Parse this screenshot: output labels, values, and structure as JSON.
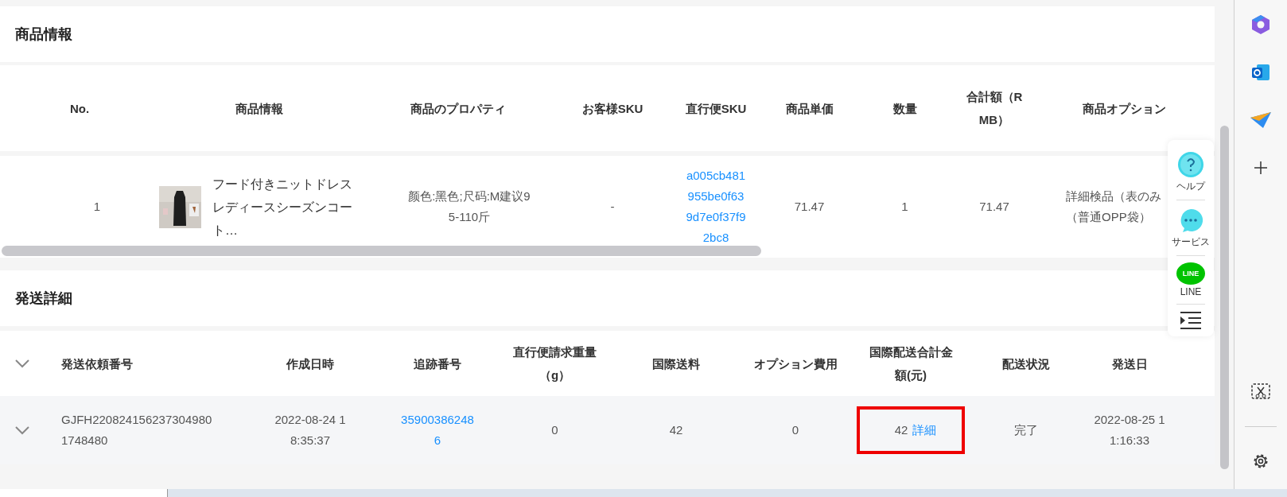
{
  "product_section": {
    "title": "商品情報",
    "columns": [
      "No.",
      "商品情報",
      "商品のプロパティ",
      "お客様SKU",
      "直行便SKU",
      "商品単価",
      "数量",
      "合計額（RMB）",
      "商品オプション"
    ],
    "rows": [
      {
        "no": "1",
        "image": {
          "kind": "picture"
        },
        "name": "フード付きニットドレスレディースシーズンコート…",
        "property": "颜色:黑色;尺码:M建议95-110斤",
        "customer_sku": "-",
        "sku": "a005cb481955be0f639d7e0f37f92bc8",
        "price": "71.47",
        "quantity": "1",
        "total": "71.47",
        "option_lines": [
          "詳細検品（表のみ",
          "（普通OPP袋）"
        ]
      }
    ]
  },
  "shipping_section": {
    "title": "発送詳細",
    "columns": [
      "発送依頼番号",
      "作成日時",
      "追跡番号",
      "直行便請求重量（g）",
      "国際送料",
      "オプション費用",
      "国際配送合計金額(元)",
      "配送状況",
      "発送日"
    ],
    "rows": [
      {
        "expanded": false,
        "request_no": "GJFH2208241562373049801748480",
        "created": "2022-08-24 18:35:37",
        "tracking": "359003862486",
        "weight": "0",
        "shipping_fee": "42",
        "option_fee": "0",
        "total": "42",
        "detail_link": "詳細",
        "highlighted": true,
        "status": "完了",
        "ship_date": "2022-08-25 11:16:33"
      }
    ]
  },
  "float_menu": {
    "items": [
      {
        "kind": "help",
        "label": "ヘルプ"
      },
      {
        "kind": "service",
        "label": "サービス"
      },
      {
        "kind": "line",
        "label": "LINE",
        "badge": "LINE"
      }
    ]
  }
}
